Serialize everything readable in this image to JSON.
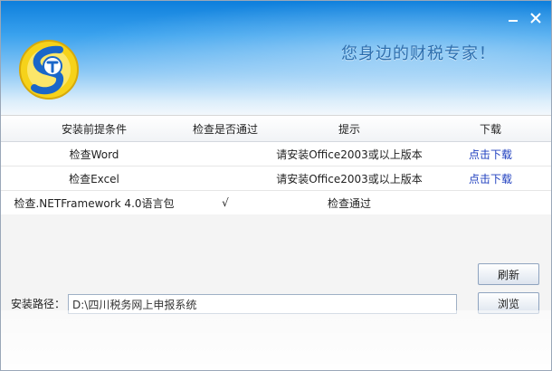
{
  "window": {
    "minimize_icon": "minimize-icon",
    "close_icon": "close-icon"
  },
  "banner": {
    "logo_icon": "tax-logo-icon",
    "slogan": "您身边的财税专家！"
  },
  "table": {
    "headers": [
      "安装前提条件",
      "检查是否通过",
      "提示",
      "下载"
    ],
    "rows": [
      {
        "condition": "检查Word",
        "passed": "",
        "hint": "请安装Office2003或以上版本",
        "download": "点击下载"
      },
      {
        "condition": "检查Excel",
        "passed": "",
        "hint": "请安装Office2003或以上版本",
        "download": "点击下载"
      },
      {
        "condition": "检查.NETFramework 4.0语言包",
        "passed": "√",
        "hint": "检查通过",
        "download": ""
      }
    ]
  },
  "actions": {
    "refresh_label": "刷新",
    "browse_label": "浏览"
  },
  "install": {
    "path_label": "安装路径：",
    "path_value": "D:\\四川税务网上申报系统"
  },
  "colors": {
    "banner_top": "#0e7fdc",
    "slogan": "#2f6fae",
    "link": "#1f3fbf",
    "logo_ring": "#f6d21a",
    "logo_letter": "#1a66c9"
  }
}
